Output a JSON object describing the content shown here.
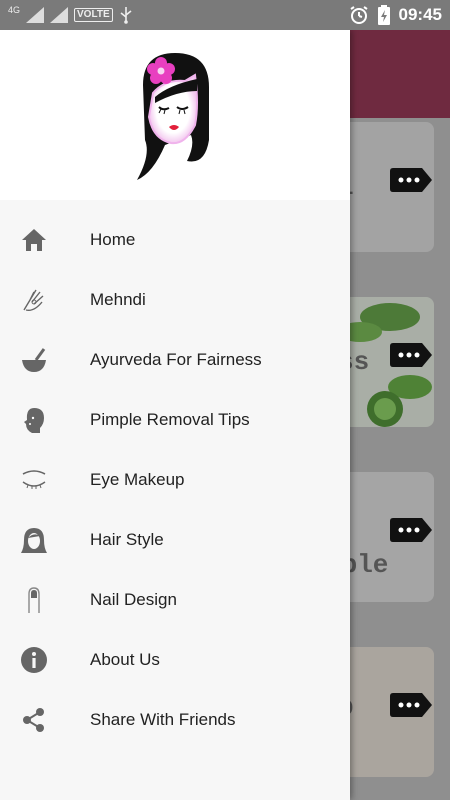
{
  "status_bar": {
    "network": "4G",
    "volte": "VOLTE",
    "time": "09:45"
  },
  "background": {
    "toolbar_color": "#6f2a40",
    "card_texts": [
      "i",
      "ss",
      "mple",
      "p"
    ]
  },
  "drawer": {
    "logo": "girl-face-logo",
    "items": [
      {
        "label": "Home",
        "icon": "home-icon"
      },
      {
        "label": "Mehndi",
        "icon": "hand-icon"
      },
      {
        "label": "Ayurveda For Fairness",
        "icon": "mortar-pestle-icon"
      },
      {
        "label": "Pimple Removal Tips",
        "icon": "face-profile-icon"
      },
      {
        "label": "Eye Makeup",
        "icon": "eye-icon"
      },
      {
        "label": "Hair Style",
        "icon": "hair-icon"
      },
      {
        "label": "Nail Design",
        "icon": "nail-icon"
      },
      {
        "label": "About Us",
        "icon": "info-icon"
      },
      {
        "label": "Share With Friends",
        "icon": "share-icon"
      }
    ]
  }
}
